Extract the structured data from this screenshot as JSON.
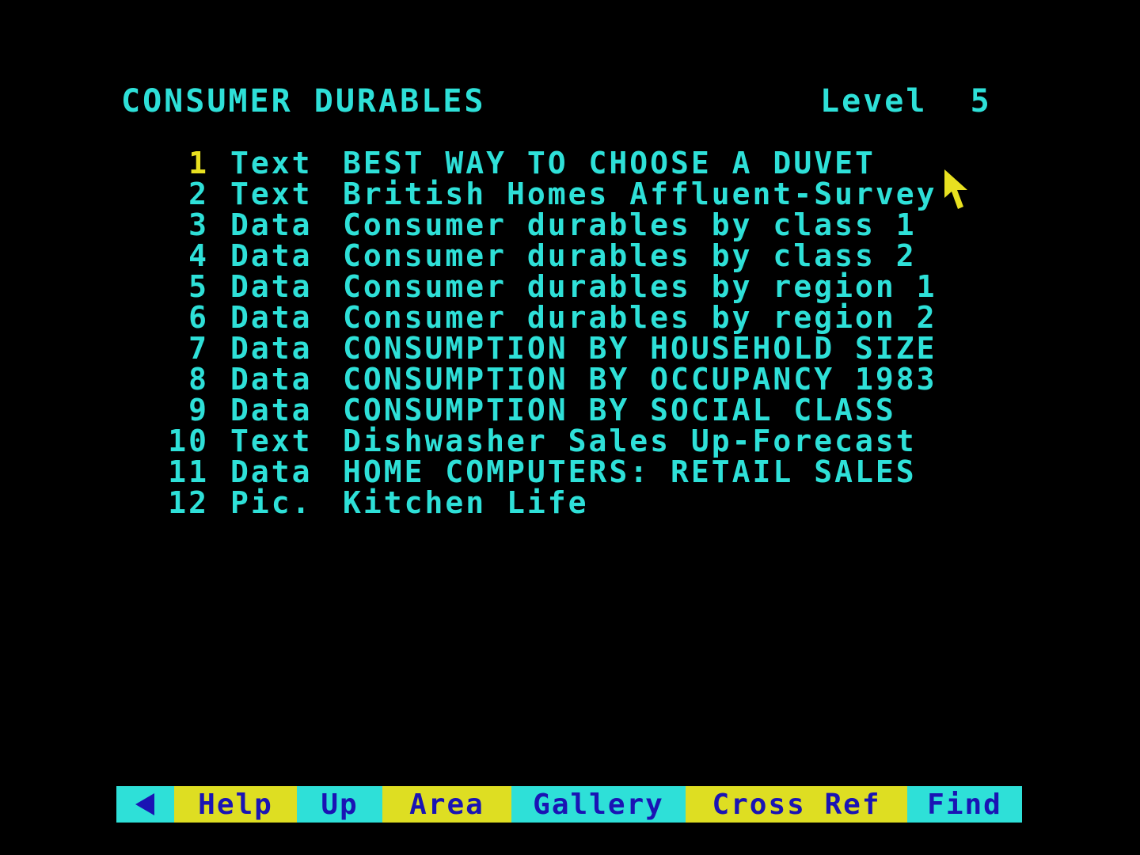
{
  "header": {
    "title": "CONSUMER DURABLES",
    "level": "Level  5"
  },
  "menu": {
    "items": [
      {
        "num": "1",
        "type": "Text",
        "title": "BEST WAY TO CHOOSE A DUVET"
      },
      {
        "num": "2",
        "type": "Text",
        "title": "British Homes Affluent-Survey"
      },
      {
        "num": "3",
        "type": "Data",
        "title": "Consumer durables by class 1"
      },
      {
        "num": "4",
        "type": "Data",
        "title": "Consumer durables by class 2"
      },
      {
        "num": "5",
        "type": "Data",
        "title": "Consumer durables by region 1"
      },
      {
        "num": "6",
        "type": "Data",
        "title": "Consumer durables by region 2"
      },
      {
        "num": "7",
        "type": "Data",
        "title": "CONSUMPTION BY HOUSEHOLD SIZE"
      },
      {
        "num": "8",
        "type": "Data",
        "title": "CONSUMPTION BY OCCUPANCY 1983"
      },
      {
        "num": "9",
        "type": "Data",
        "title": "CONSUMPTION BY SOCIAL CLASS"
      },
      {
        "num": "10",
        "type": "Text",
        "title": "Dishwasher Sales Up-Forecast"
      },
      {
        "num": "11",
        "type": "Data",
        "title": "HOME COMPUTERS: RETAIL SALES"
      },
      {
        "num": "12",
        "type": "Pic.",
        "title": "Kitchen Life"
      }
    ]
  },
  "toolbar": {
    "back_icon": "left-arrow-icon",
    "help": "Help",
    "up": "Up",
    "area": "Area",
    "gallery": "Gallery",
    "cross_ref": "Cross Ref",
    "find": "Find"
  },
  "colors": {
    "background": "#000000",
    "text": "#2ee0d8",
    "selected": "#e8e020",
    "toolbar_cyan": "#2ee0d8",
    "toolbar_yellow": "#dede22",
    "toolbar_text": "#1a14b4"
  }
}
